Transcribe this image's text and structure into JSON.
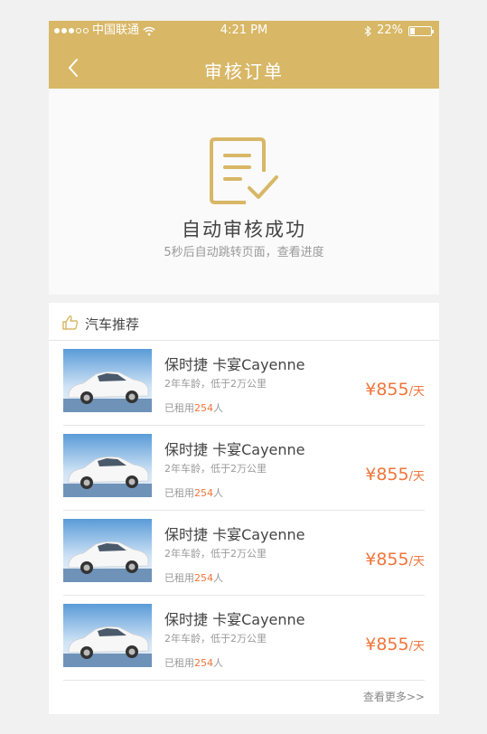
{
  "status_bar": {
    "carrier": "中国联通",
    "time": "4:21 PM",
    "battery": "22%",
    "signal_dots_filled": 3,
    "signal_dots_total": 5,
    "battery_level": 0.22
  },
  "nav": {
    "title": "审核订单",
    "back_icon": "chevron-left-icon"
  },
  "success": {
    "icon": "document-check-icon",
    "title": "自动审核成功",
    "subtitle": "5秒后自动跳转页面，查看进度"
  },
  "recommend": {
    "icon": "thumbs-up-icon",
    "title": "汽车推荐",
    "cars": [
      {
        "name": "保时捷 卡宴Cayenne",
        "meta": "2年车龄，低于2万公里",
        "rented_prefix": "已租用",
        "rented_count": "254",
        "rented_suffix": "人",
        "price": "¥855",
        "unit": "/天"
      },
      {
        "name": "保时捷 卡宴Cayenne",
        "meta": "2年车龄，低于2万公里",
        "rented_prefix": "已租用",
        "rented_count": "254",
        "rented_suffix": "人",
        "price": "¥855",
        "unit": "/天"
      },
      {
        "name": "保时捷 卡宴Cayenne",
        "meta": "2年车龄，低于2万公里",
        "rented_prefix": "已租用",
        "rented_count": "254",
        "rented_suffix": "人",
        "price": "¥855",
        "unit": "/天"
      },
      {
        "name": "保时捷 卡宴Cayenne",
        "meta": "2年车龄，低于2万公里",
        "rented_prefix": "已租用",
        "rented_count": "254",
        "rented_suffix": "人",
        "price": "¥855",
        "unit": "/天"
      }
    ],
    "more": "查看更多>>"
  },
  "colors": {
    "brand": "#d8b766",
    "price": "#f0743a"
  }
}
